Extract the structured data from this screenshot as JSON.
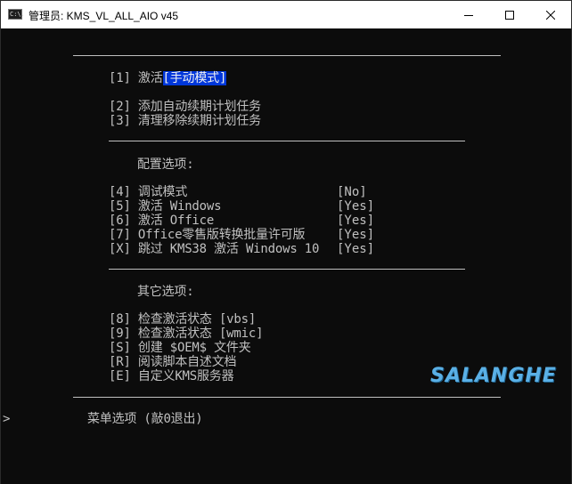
{
  "window": {
    "title": "管理员:  KMS_VL_ALL_AIO v45",
    "icon": "console-icon",
    "icon_text": "C:\\."
  },
  "menu": {
    "activate": {
      "key": "[1]",
      "label": "激活",
      "mode": "[手动模式]"
    },
    "tasks": [
      {
        "key": "[2]",
        "label": "添加自动续期计划任务"
      },
      {
        "key": "[3]",
        "label": "清理移除续期计划任务"
      }
    ],
    "config_header": "配置选项:",
    "config": [
      {
        "key": "[4]",
        "label": "调试模式",
        "value": "[No]"
      },
      {
        "key": "[5]",
        "label": "激活 Windows",
        "value": "[Yes]"
      },
      {
        "key": "[6]",
        "label": "激活 Office",
        "value": "[Yes]"
      },
      {
        "key": "[7]",
        "label": "Office零售版转换批量许可版",
        "value": "[Yes]"
      },
      {
        "key": "[X]",
        "label": "跳过 KMS38 激活 Windows 10",
        "value": "[Yes]"
      }
    ],
    "other_header": "其它选项:",
    "other": [
      {
        "key": "[8]",
        "label": "检查激活状态 [vbs]"
      },
      {
        "key": "[9]",
        "label": "检查激活状态 [wmic]"
      },
      {
        "key": "[S]",
        "label": "创建 $OEM$ 文件夹"
      },
      {
        "key": "[R]",
        "label": "阅读脚本自述文档"
      },
      {
        "key": "[E]",
        "label": "自定义KMS服务器"
      }
    ],
    "prompt": "菜单选项 (敲0退出)",
    "prompt_mark": ">"
  },
  "watermark": "SALANGHE"
}
